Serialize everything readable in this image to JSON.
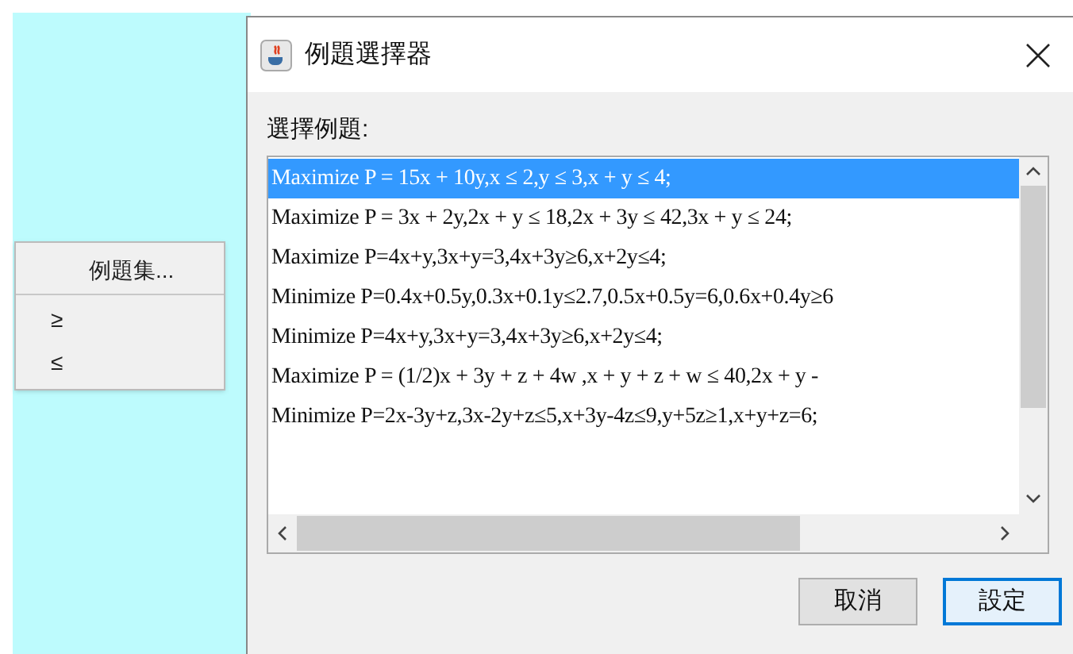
{
  "context_menu": {
    "items": [
      {
        "label": "例題集...",
        "kind": "header"
      },
      {
        "label": "≥",
        "kind": "item"
      },
      {
        "label": "≤",
        "kind": "item"
      }
    ]
  },
  "dialog": {
    "title": "例題選擇器",
    "prompt": "選擇例題:",
    "list": [
      {
        "text": "Maximize P = 15x + 10y,x ≤ 2,y ≤ 3,x + y ≤ 4;",
        "selected": true
      },
      {
        "text": "Maximize P = 3x + 2y,2x + y ≤ 18,2x + 3y ≤ 42,3x + y ≤ 24;",
        "selected": false
      },
      {
        "text": "Maximize P=4x+y,3x+y=3,4x+3y≥6,x+2y≤4;",
        "selected": false
      },
      {
        "text": "Minimize P=0.4x+0.5y,0.3x+0.1y≤2.7,0.5x+0.5y=6,0.6x+0.4y≥6",
        "selected": false
      },
      {
        "text": "Minimize P=4x+y,3x+y=3,4x+3y≥6,x+2y≤4;",
        "selected": false
      },
      {
        "text": "Maximize P = (1/2)x + 3y + z + 4w ,x + y + z + w ≤ 40,2x + y -",
        "selected": false
      },
      {
        "text": "Minimize P=2x-3y+z,3x-2y+z≤5,x+3y-4z≤9,y+5z≥1,x+y+z=6;",
        "selected": false
      }
    ],
    "buttons": [
      {
        "label": "取消",
        "kind": "cancel"
      },
      {
        "label": "設定",
        "kind": "default"
      }
    ]
  }
}
